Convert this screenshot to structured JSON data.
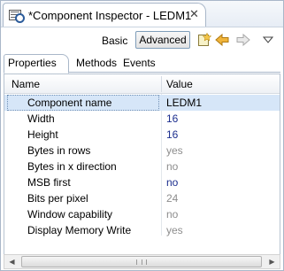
{
  "view": {
    "title": "*Component Inspector - LEDM1",
    "close_symbol": "✕"
  },
  "toolbar": {
    "basic_label": "Basic",
    "advanced_label": "Advanced",
    "icons": [
      "new-note-icon",
      "back-arrow-icon",
      "forward-arrow-icon",
      "view-menu-icon"
    ]
  },
  "tabs": [
    {
      "label": "Properties",
      "active": true
    },
    {
      "label": "Methods",
      "active": false
    },
    {
      "label": "Events",
      "active": false
    }
  ],
  "grid": {
    "columns": [
      "Name",
      "Value"
    ],
    "rows": [
      {
        "name": "Component name",
        "value": "LEDM1",
        "style": "normal",
        "selected": true
      },
      {
        "name": "Width",
        "value": "16",
        "style": "blue"
      },
      {
        "name": "Height",
        "value": "16",
        "style": "blue"
      },
      {
        "name": "Bytes in rows",
        "value": "yes",
        "style": "gray"
      },
      {
        "name": "Bytes in x direction",
        "value": "no",
        "style": "gray"
      },
      {
        "name": "MSB first",
        "value": "no",
        "style": "blue"
      },
      {
        "name": "Bits per pixel",
        "value": "24",
        "style": "gray"
      },
      {
        "name": "Window capability",
        "value": "no",
        "style": "gray"
      },
      {
        "name": "Display Memory Write",
        "value": "yes",
        "style": "gray"
      }
    ]
  },
  "colors": {
    "selection": "#d6e6f8",
    "value_blue": "#1b2e8e",
    "value_gray": "#8d8d8d",
    "note_yellow": "#f3c64a",
    "nav_arrow": "#e0a21b"
  }
}
